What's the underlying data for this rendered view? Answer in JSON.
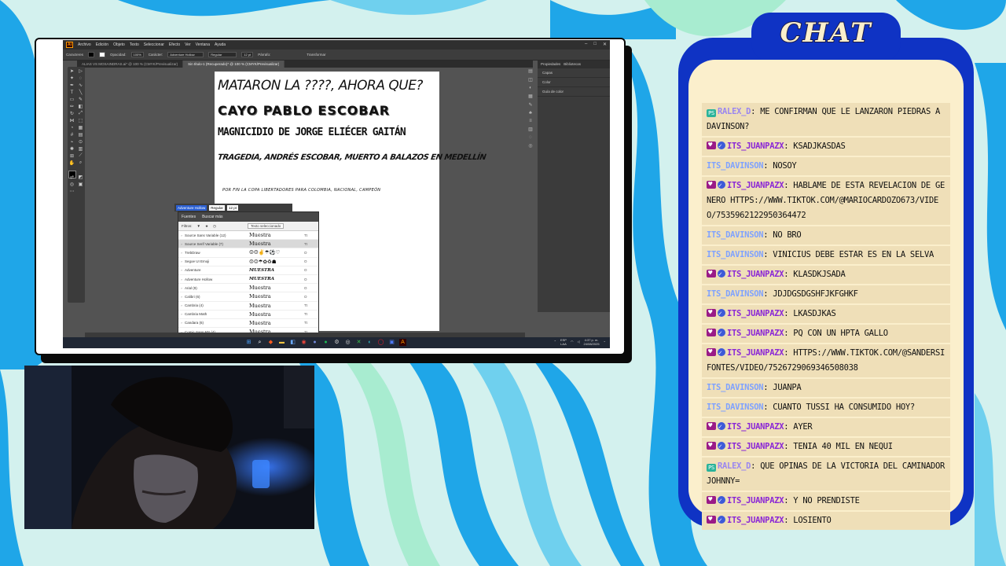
{
  "colors": {
    "chat_border": "#0f33c4",
    "chat_bg": "#fbefcc",
    "msg_bg": "#efdfb8",
    "user_purple": "#8a26d6",
    "user_blue": "#7fa2ff",
    "bg_wave_blue": "#1fa6e8",
    "bg_wave_mint": "#a8ecd0"
  },
  "screen": {
    "menu": [
      "Archivo",
      "Edición",
      "Objeto",
      "Texto",
      "Seleccionar",
      "Efecto",
      "Ver",
      "Ventana",
      "Ayuda"
    ],
    "control_bar": {
      "label": "Caracteres",
      "opacity_label": "Opacidad:",
      "opacity_value": "100%",
      "char_label": "Carácter:",
      "font": "Adventure Hollow",
      "style": "Regular",
      "size": "12 pt",
      "paragraph_label": "Párrafo:",
      "transform_label": "Transformar"
    },
    "doc_tabs": [
      "ALIAS VS MOSAINDRAS.ai* @ 100 % (CMYK/Previsualizar)",
      "Sin título-1 (Recuperado)* @ 100 % (CMYK/Previsualizar)"
    ],
    "artboard_lines": [
      "MATARON LA ????, AHORA QUE?",
      "CAYO PABLO ESCOBAR",
      "MAGNICIDIO DE JORGE ELIÉCER GAITÁN",
      "TRAGEDIA, ANDRÉS ESCOBAR, MUERTO A BALAZOS EN MEDELLÍN",
      "POR FIN LA COPA LIBERTADORES PARA COLOMBIA, NACIONAL, CAMPEÓN"
    ],
    "right_panel": {
      "tabs": [
        "Propiedades",
        "Bibliotecas"
      ],
      "rows": [
        "Capas",
        "Color",
        "Guía de color"
      ]
    },
    "font_picker": {
      "input_value": "Adventure Hollow",
      "style_value": "Regular",
      "size_value": "12 pt",
      "tabs": [
        "Fuentes",
        "Buscar más"
      ],
      "filters_label": "Filtros:",
      "dropdown": "Texto seleccionado",
      "rows": [
        {
          "name": "Source Sans Variable (12)",
          "sample": "Muestra",
          "type": "Tt"
        },
        {
          "name": "Source Serif Variable (7)",
          "sample": "Muestra",
          "type": "Tt"
        },
        {
          "name": "TrebDraw",
          "sample": "☺☹✌☂⚽♡",
          "type": "O"
        },
        {
          "name": "Segoe UI Emoji",
          "sample": "☹☺☂✿♻☗",
          "type": "O"
        },
        {
          "name": "Adventure",
          "sample": "MUESTRA",
          "type": "O"
        },
        {
          "name": "Adventure Hollow",
          "sample": "MUESTRA",
          "type": "O"
        },
        {
          "name": "Arial (9)",
          "sample": "Muestra",
          "type": "O"
        },
        {
          "name": "Calibri (6)",
          "sample": "Muestra",
          "type": "O"
        },
        {
          "name": "Cambria (4)",
          "sample": "Muestra",
          "type": "Tt"
        },
        {
          "name": "Cambria Math",
          "sample": "Muestra",
          "type": "Tt"
        },
        {
          "name": "Candara (6)",
          "sample": "Muestra",
          "type": "Tt"
        },
        {
          "name": "Comic Sans MS (4)",
          "sample": "Muestra",
          "type": "Tt"
        }
      ]
    },
    "tray": {
      "lang": "ESP",
      "region": "LAA",
      "time": "4:37 p. m.",
      "date": "24/08/2025"
    }
  },
  "chat": {
    "title": "CHAT",
    "messages": [
      {
        "badges": [
          "ps"
        ],
        "user": "RALEX_D",
        "color": "ralex",
        "text": ": ME CONFIRMAN QUE LE LANZARON PIEDRAS A DAVINSON?"
      },
      {
        "badges": [
          "heart",
          "check"
        ],
        "user": "ITS_JUANPAZX",
        "color": "purple",
        "text": ": KSADJKASDAS"
      },
      {
        "badges": [],
        "user": "ITS_DAVINSON",
        "color": "blue",
        "text": ": NOSOY"
      },
      {
        "badges": [
          "heart",
          "check"
        ],
        "user": "ITS_JUANPAZX",
        "color": "purple",
        "text": ": HABLAME DE ESTA REVELACION DE GENERO HTTPS://WWW.TIKTOK.COM/@MARIOCARDOZO673/VIDEO/7535962122950364472"
      },
      {
        "badges": [],
        "user": "ITS_DAVINSON",
        "color": "blue",
        "text": ": NO BRO"
      },
      {
        "badges": [],
        "user": "ITS_DAVINSON",
        "color": "blue",
        "text": ": VINICIUS DEBE ESTAR ES EN LA SELVA"
      },
      {
        "badges": [
          "heart",
          "check"
        ],
        "user": "ITS_JUANPAZX",
        "color": "purple",
        "text": ": KLASDKJSADA"
      },
      {
        "badges": [],
        "user": "ITS_DAVINSON",
        "color": "blue",
        "text": ": JDJDGSDGSHFJKFGHKF"
      },
      {
        "badges": [
          "heart",
          "check"
        ],
        "user": "ITS_JUANPAZX",
        "color": "purple",
        "text": ": LKASDJKAS"
      },
      {
        "badges": [
          "heart",
          "check"
        ],
        "user": "ITS_JUANPAZX",
        "color": "purple",
        "text": ": PQ CON UN HPTA GALLO"
      },
      {
        "badges": [
          "heart",
          "check"
        ],
        "user": "ITS_JUANPAZX",
        "color": "purple",
        "text": ": HTTPS://WWW.TIKTOK.COM/@SANDERSIFONTES/VIDEO/7526729069346508038"
      },
      {
        "badges": [],
        "user": "ITS_DAVINSON",
        "color": "blue",
        "text": ": JUANPA"
      },
      {
        "badges": [],
        "user": "ITS_DAVINSON",
        "color": "blue",
        "text": ": CUANTO TUSSI HA CONSUMIDO HOY?"
      },
      {
        "badges": [
          "heart",
          "check"
        ],
        "user": "ITS_JUANPAZX",
        "color": "purple",
        "text": ": AYER"
      },
      {
        "badges": [
          "heart",
          "check"
        ],
        "user": "ITS_JUANPAZX",
        "color": "purple",
        "text": ": TENIA 40 MIL EN NEQUI"
      },
      {
        "badges": [
          "ps"
        ],
        "user": "RALEX_D",
        "color": "ralex",
        "text": ": QUE OPINAS DE LA VICTORIA DEL CAMINADOR JOHNNY="
      },
      {
        "badges": [
          "heart",
          "check"
        ],
        "user": "ITS_JUANPAZX",
        "color": "purple",
        "text": ": Y NO PRENDISTE"
      },
      {
        "badges": [
          "heart",
          "check"
        ],
        "user": "ITS_JUANPAZX",
        "color": "purple",
        "text": ": LOSIENTO"
      }
    ]
  }
}
